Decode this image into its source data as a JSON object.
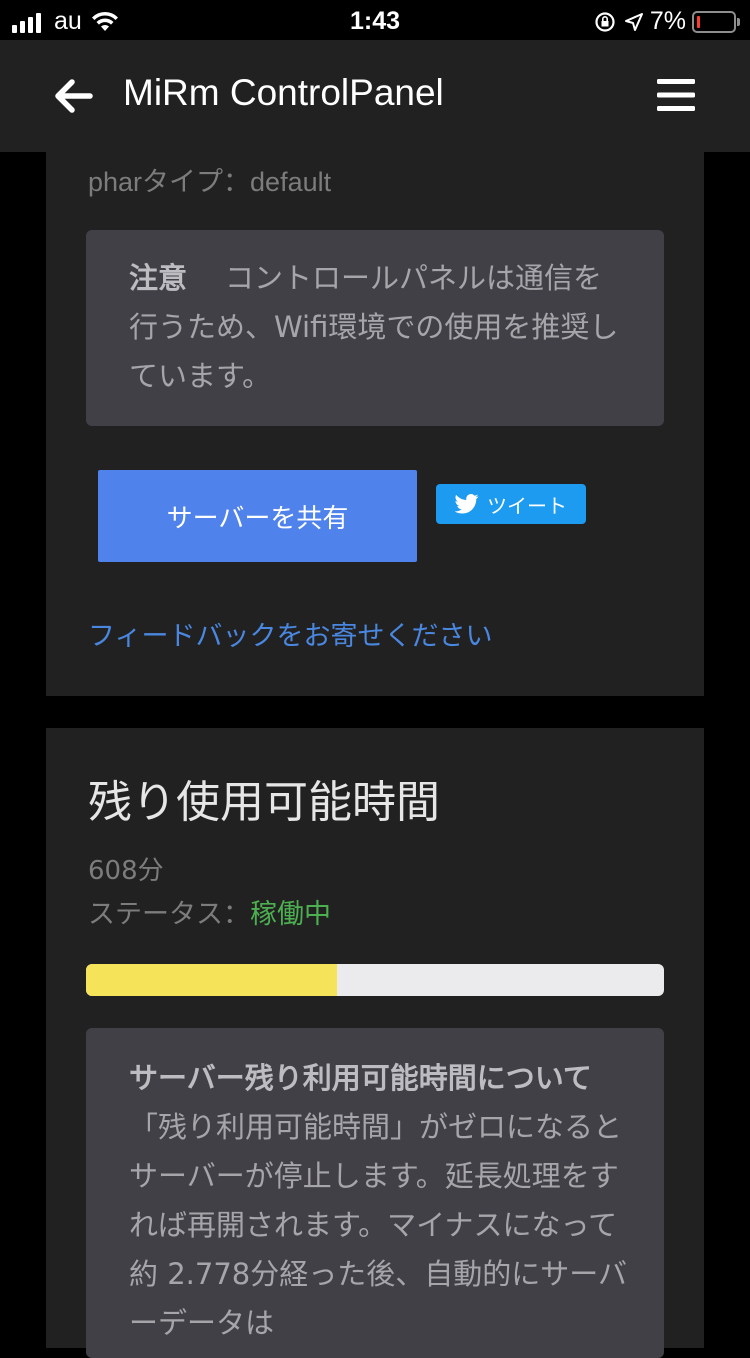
{
  "status_bar": {
    "carrier": "au",
    "time": "1:43",
    "battery_percent_text": "7%",
    "battery_level": 0.07,
    "battery_color": "#ff3b30"
  },
  "app_bar": {
    "back_icon": "arrow-left",
    "title": "MiRm ControlPanel",
    "menu_icon": "hamburger-menu"
  },
  "server_card": {
    "phar_type": "pharタイプ：default",
    "notice": {
      "heading": "注意",
      "body": "コントロールパネルは通信を行うため、Wifi環境での使用を推奨しています。"
    },
    "share_button": "サーバーを共有",
    "tweet_button": "ツイート",
    "feedback_link": "フィードバックをお寄せください"
  },
  "remaining_card": {
    "title": "残り使用可能時間",
    "minutes": "608分",
    "status_label": "ステータス：",
    "status_value": "稼働中",
    "progress_fraction": 0.435,
    "progress_color": "#f5e35a",
    "info": {
      "heading": "サーバー残り利用可能時間について",
      "body": "「残り利用可能時間」がゼロになるとサーバーが停止します。延長処理をすれば再開されます。マイナスになって約 2.778分経った後、自動的にサーバーデータは"
    }
  },
  "colors": {
    "accent_blue": "#4f82ea",
    "twitter_blue": "#1d9bf0",
    "link_blue": "#4a87e0",
    "status_green": "#4caf50"
  }
}
